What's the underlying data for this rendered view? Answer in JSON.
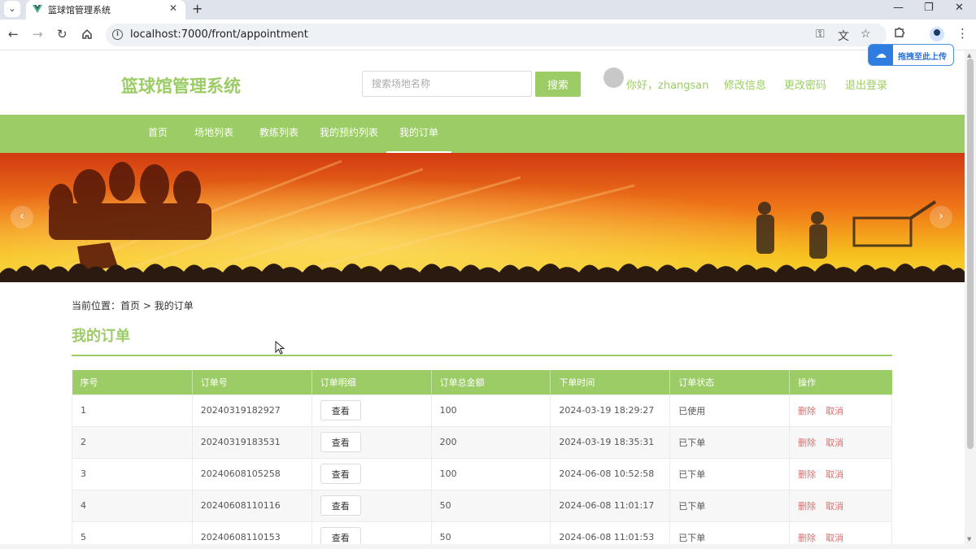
{
  "browser": {
    "tab_title": "篮球馆管理系统",
    "url": "localhost:7000/front/appointment",
    "upload_label": "拖拽至此上传"
  },
  "header": {
    "site_title": "篮球馆管理系统",
    "search_placeholder": "搜索场地名称",
    "search_button": "搜索",
    "greeting": "你好，zhangsan",
    "links": [
      "修改信息",
      "更改密码",
      "退出登录"
    ]
  },
  "nav": {
    "items": [
      "首页",
      "场地列表",
      "教练列表",
      "我的预约列表",
      "我的订单"
    ],
    "active_index": 4
  },
  "breadcrumb": {
    "prefix": "当前位置：",
    "home": "首页",
    "sep": ">",
    "current": "我的订单"
  },
  "page_title": "我的订单",
  "table": {
    "headers": [
      "序号",
      "订单号",
      "订单明细",
      "订单总金额",
      "下单时间",
      "订单状态",
      "操作"
    ],
    "view_label": "查看",
    "delete_label": "删除",
    "cancel_label": "取消",
    "rows": [
      {
        "no": "1",
        "order_no": "20240319182927",
        "amount": "100",
        "time": "2024-03-19 18:29:27",
        "status": "已使用"
      },
      {
        "no": "2",
        "order_no": "20240319183531",
        "amount": "200",
        "time": "2024-03-19 18:35:31",
        "status": "已下单"
      },
      {
        "no": "3",
        "order_no": "20240608105258",
        "amount": "100",
        "time": "2024-06-08 10:52:58",
        "status": "已下单"
      },
      {
        "no": "4",
        "order_no": "20240608110116",
        "amount": "50",
        "time": "2024-06-08 11:01:17",
        "status": "已下单"
      },
      {
        "no": "5",
        "order_no": "20240608110153",
        "amount": "50",
        "time": "2024-06-08 11:01:53",
        "status": "已下单"
      }
    ]
  },
  "colors": {
    "accent": "#9ccc65",
    "danger": "#e06c6c"
  }
}
